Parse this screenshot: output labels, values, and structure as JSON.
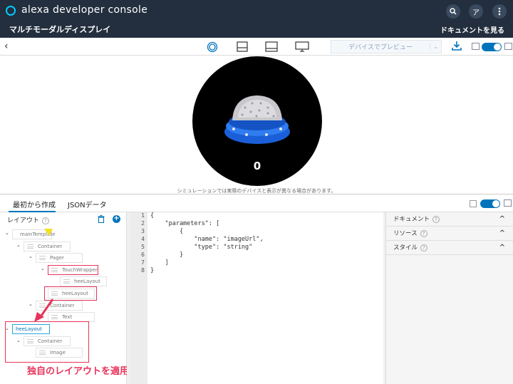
{
  "header": {
    "app_title": "alexa developer console",
    "skill_name": "マルチモーダルディスプレイ",
    "doc_link": "ドキュメントを見る",
    "search_label": "🔍",
    "user_initial": "ア",
    "menu_label": "⋮"
  },
  "toolbar": {
    "back_label": "‹",
    "preview_select": "デバイスでプレビュー",
    "preview_chevron": "⌄"
  },
  "preview": {
    "counter": "0",
    "note": "シミュレーションでは実際のデバイスと表示が異なる場合があります。"
  },
  "editor_tabs": [
    "最初から作成",
    "JSONデータ"
  ],
  "layout_pane": {
    "title": "レイアウト",
    "help": "?",
    "plus": "+",
    "nodes": {
      "mainTemplate": "mainTemplate",
      "container1": "Container",
      "pager": "Pager",
      "touchWrapper": "TouchWrapper",
      "heeLayout_a": "heeLayout",
      "heeLayout_b": "heeLayout",
      "container2": "Container",
      "text": "Text",
      "heeLayout_root": "heeLayout",
      "container3": "Container",
      "image": "Image"
    },
    "caret": "⌄"
  },
  "callout": "独自のレイアウトを適用できる",
  "code": {
    "line_numbers": [
      "1",
      "2",
      "3",
      "4",
      "5",
      "6",
      "7",
      "8"
    ],
    "lines": [
      "{",
      "    \"parameters\": [",
      "        {",
      "            \"name\": \"imageUrl\",",
      "            \"type\": \"string\"",
      "        }",
      "    ]",
      "}"
    ]
  },
  "side_pane": {
    "rows": [
      "ドキュメント",
      "リソース",
      "スタイル"
    ],
    "help": "?",
    "chevron": "^"
  },
  "colors": {
    "header_bg": "#232f3e",
    "accent": "#0073bb",
    "highlight": "#e8335a",
    "alexa_ring": "#00caff"
  }
}
